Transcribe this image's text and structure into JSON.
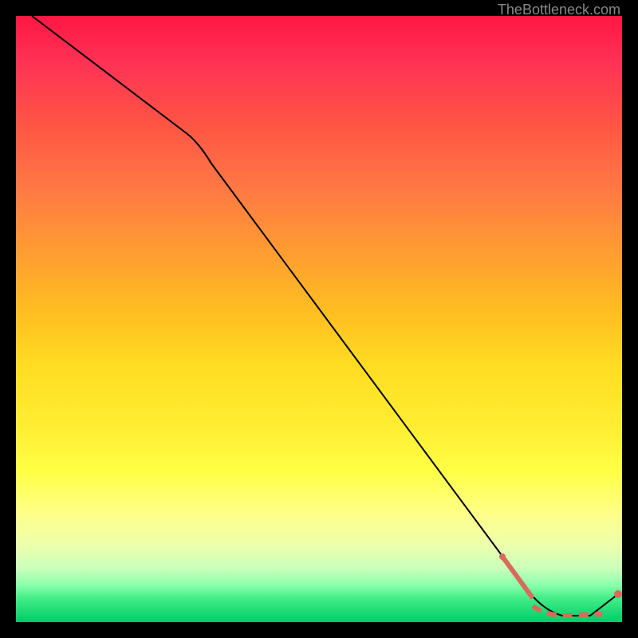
{
  "watermark": "TheBottleneck.com",
  "chart_data": {
    "type": "line",
    "title": "",
    "xlabel": "",
    "ylabel": "",
    "x": [
      0,
      30,
      85,
      88,
      92,
      100
    ],
    "values": [
      100,
      80,
      5,
      0,
      0,
      4
    ],
    "highlighted_segment": {
      "x_start": 82,
      "x_end": 100,
      "style": "dashed-red"
    },
    "ylim": [
      0,
      100
    ],
    "xlim": [
      0,
      100
    ]
  },
  "colors": {
    "background": "#000000",
    "gradient_top": "#ff1744",
    "gradient_bottom": "#00cc66",
    "line": "#000000",
    "highlight": "#d86b5c"
  }
}
